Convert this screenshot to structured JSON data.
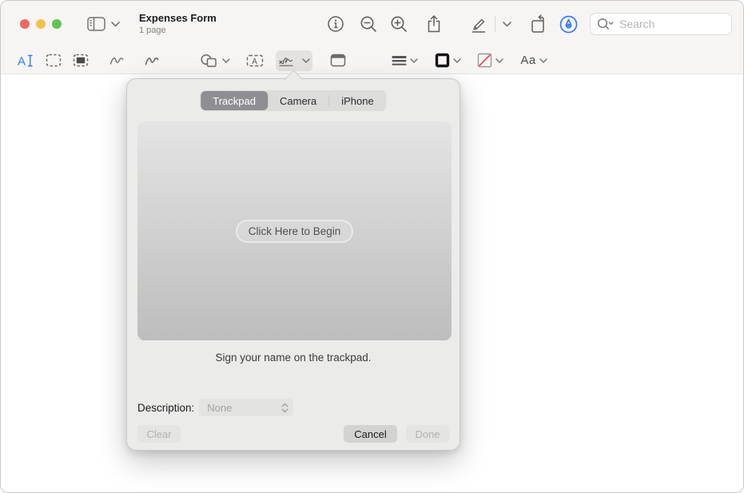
{
  "titlebar": {
    "title": "Expenses Form",
    "subtitle": "1 page",
    "search_placeholder": "Search"
  },
  "toolbar": {
    "text_style_label": "Aa"
  },
  "popover": {
    "tabs": [
      {
        "label": "Trackpad",
        "selected": true
      },
      {
        "label": "Camera",
        "selected": false
      },
      {
        "label": "iPhone",
        "selected": false
      }
    ],
    "begin_button_label": "Click Here to Begin",
    "caption": "Sign your name on the trackpad.",
    "description_label": "Description:",
    "description_value": "None",
    "clear_label": "Clear",
    "cancel_label": "Cancel",
    "done_label": "Done"
  },
  "icons": [
    "close-icon",
    "minimize-icon",
    "zoom-window-icon",
    "sidebar-icon",
    "chevron-down-icon",
    "info-icon",
    "zoom-out-icon",
    "zoom-in-icon",
    "share-icon",
    "highlight-pen-icon",
    "rotate-icon",
    "markup-pen-icon",
    "search-icon",
    "text-select-icon",
    "rect-select-icon",
    "redact-icon",
    "sketch-icon",
    "draw-icon",
    "shapes-icon",
    "text-box-icon",
    "signature-icon",
    "note-icon",
    "line-style-icon",
    "border-color-icon",
    "fill-color-icon",
    "stepper-icon"
  ],
  "colors": {
    "accent_blue": "#3478F6",
    "traffic_red": "#EE6A5F",
    "traffic_yellow": "#F5BF4F",
    "traffic_green": "#61C554",
    "fill_none_red": "#E0443E",
    "popover_bg": "#EBEBE9",
    "segment_selected": "#8F8F93"
  }
}
